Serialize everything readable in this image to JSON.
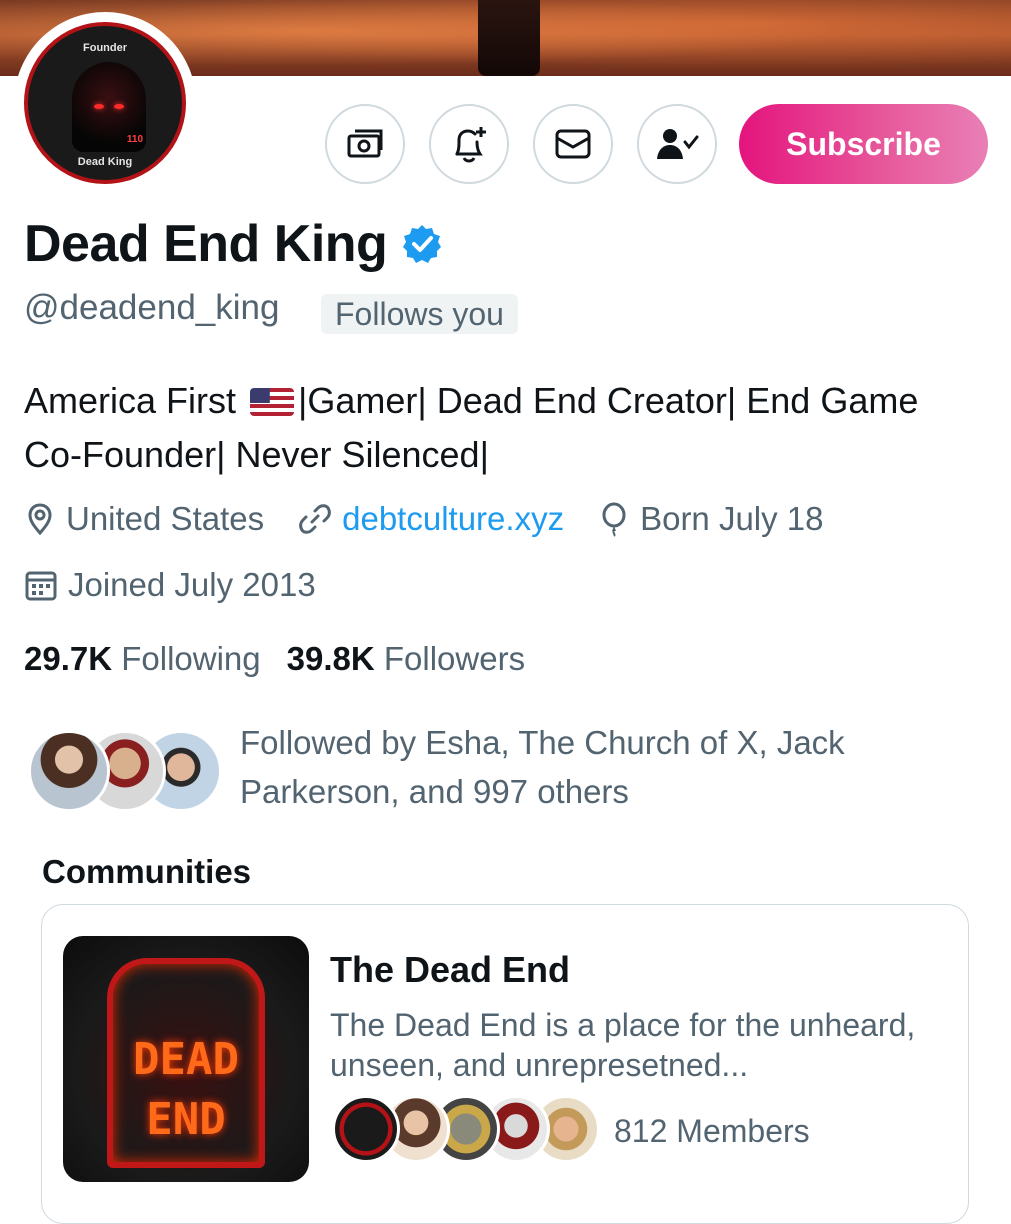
{
  "profile": {
    "name": "Dead End King",
    "handle": "@deadend_king",
    "follows_you": "Follows you",
    "verified": true,
    "avatar_ring_top": "Founder",
    "avatar_ring_bottom": "Dead King",
    "avatar_badge": "110",
    "bio_part1": "America First",
    "bio_part2": "|Gamer| Dead End Creator| End Game Co-Founder| Never Silenced|"
  },
  "actions": {
    "subscribe_label": "Subscribe",
    "icons": [
      "tip-money-icon",
      "notification-bell-add-icon",
      "message-envelope-icon",
      "following-person-check-icon"
    ]
  },
  "meta": {
    "location": "United States",
    "website": "debtculture.xyz",
    "birthday": "Born July 18",
    "joined": "Joined July 2013"
  },
  "stats": {
    "following_count": "29.7K",
    "following_label": "Following",
    "followers_count": "39.8K",
    "followers_label": "Followers"
  },
  "followed_by": {
    "text": "Followed by Esha, The Church of X, Jack Parkerson, and 997 others"
  },
  "communities": {
    "section_title": "Communities",
    "items": [
      {
        "name": "The Dead End",
        "description": "The Dead End is a place for the unheard, unseen, and unrepresetned...",
        "image_text_line1": "DEAD",
        "image_text_line2": "END",
        "members": "812 Members"
      }
    ]
  },
  "colors": {
    "accent_blue": "#1d9bf0",
    "subscribe_pink": "#e4147d",
    "secondary_text": "#536471"
  }
}
